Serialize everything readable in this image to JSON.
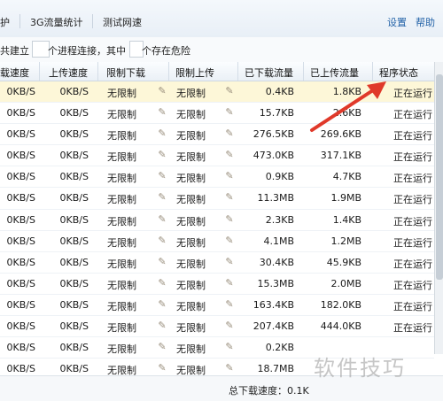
{
  "toolbar": {
    "tab_protect": "护",
    "tab_3g": "3G流量统计",
    "tab_speed": "测试网速",
    "settings_label": "设置",
    "help_label": "帮助"
  },
  "info_bar": {
    "prefix": "共建立",
    "count": "",
    "middle": "个进程连接，其中",
    "danger_count": "",
    "suffix": "个存在危险"
  },
  "table": {
    "headers": [
      "载速度",
      "上传速度",
      "限制下载",
      "限制上传",
      "已下载流量",
      "已上传流量",
      "程序状态"
    ],
    "rows": [
      [
        "0KB/S",
        "0KB/S",
        "无限制",
        "无限制",
        "0.4KB",
        "1.8KB",
        "正在运行"
      ],
      [
        "0KB/S",
        "0KB/S",
        "无限制",
        "无限制",
        "15.7KB",
        "2.6KB",
        "正在运行"
      ],
      [
        "0KB/S",
        "0KB/S",
        "无限制",
        "无限制",
        "276.5KB",
        "269.6KB",
        "正在运行"
      ],
      [
        "0KB/S",
        "0KB/S",
        "无限制",
        "无限制",
        "473.0KB",
        "317.1KB",
        "正在运行"
      ],
      [
        "0KB/S",
        "0KB/S",
        "无限制",
        "无限制",
        "0.9KB",
        "4.7KB",
        "正在运行"
      ],
      [
        "0KB/S",
        "0KB/S",
        "无限制",
        "无限制",
        "11.3MB",
        "1.9MB",
        "正在运行"
      ],
      [
        "0KB/S",
        "0KB/S",
        "无限制",
        "无限制",
        "2.3KB",
        "1.4KB",
        "正在运行"
      ],
      [
        "0KB/S",
        "0KB/S",
        "无限制",
        "无限制",
        "4.1MB",
        "1.2MB",
        "正在运行"
      ],
      [
        "0KB/S",
        "0KB/S",
        "无限制",
        "无限制",
        "30.4KB",
        "45.9KB",
        "正在运行"
      ],
      [
        "0KB/S",
        "0KB/S",
        "无限制",
        "无限制",
        "15.3MB",
        "2.0MB",
        "正在运行"
      ],
      [
        "0KB/S",
        "0KB/S",
        "无限制",
        "无限制",
        "163.4KB",
        "182.0KB",
        "正在运行"
      ],
      [
        "0KB/S",
        "0KB/S",
        "无限制",
        "无限制",
        "207.4KB",
        "444.0KB",
        "正在运行"
      ],
      [
        "0KB/S",
        "0KB/S",
        "无限制",
        "无限制",
        "0.2KB",
        "",
        ""
      ],
      [
        "0KB/S",
        "0KB/S",
        "无限制",
        "无限制",
        "18.7MB",
        "",
        ""
      ]
    ]
  },
  "footer": {
    "total_download": "总下载速度：0.1K"
  },
  "watermark": "软件技巧",
  "colors": {
    "selected_row": "#fdf7d8",
    "link": "#2463a8",
    "arrow": "#e0392a"
  }
}
